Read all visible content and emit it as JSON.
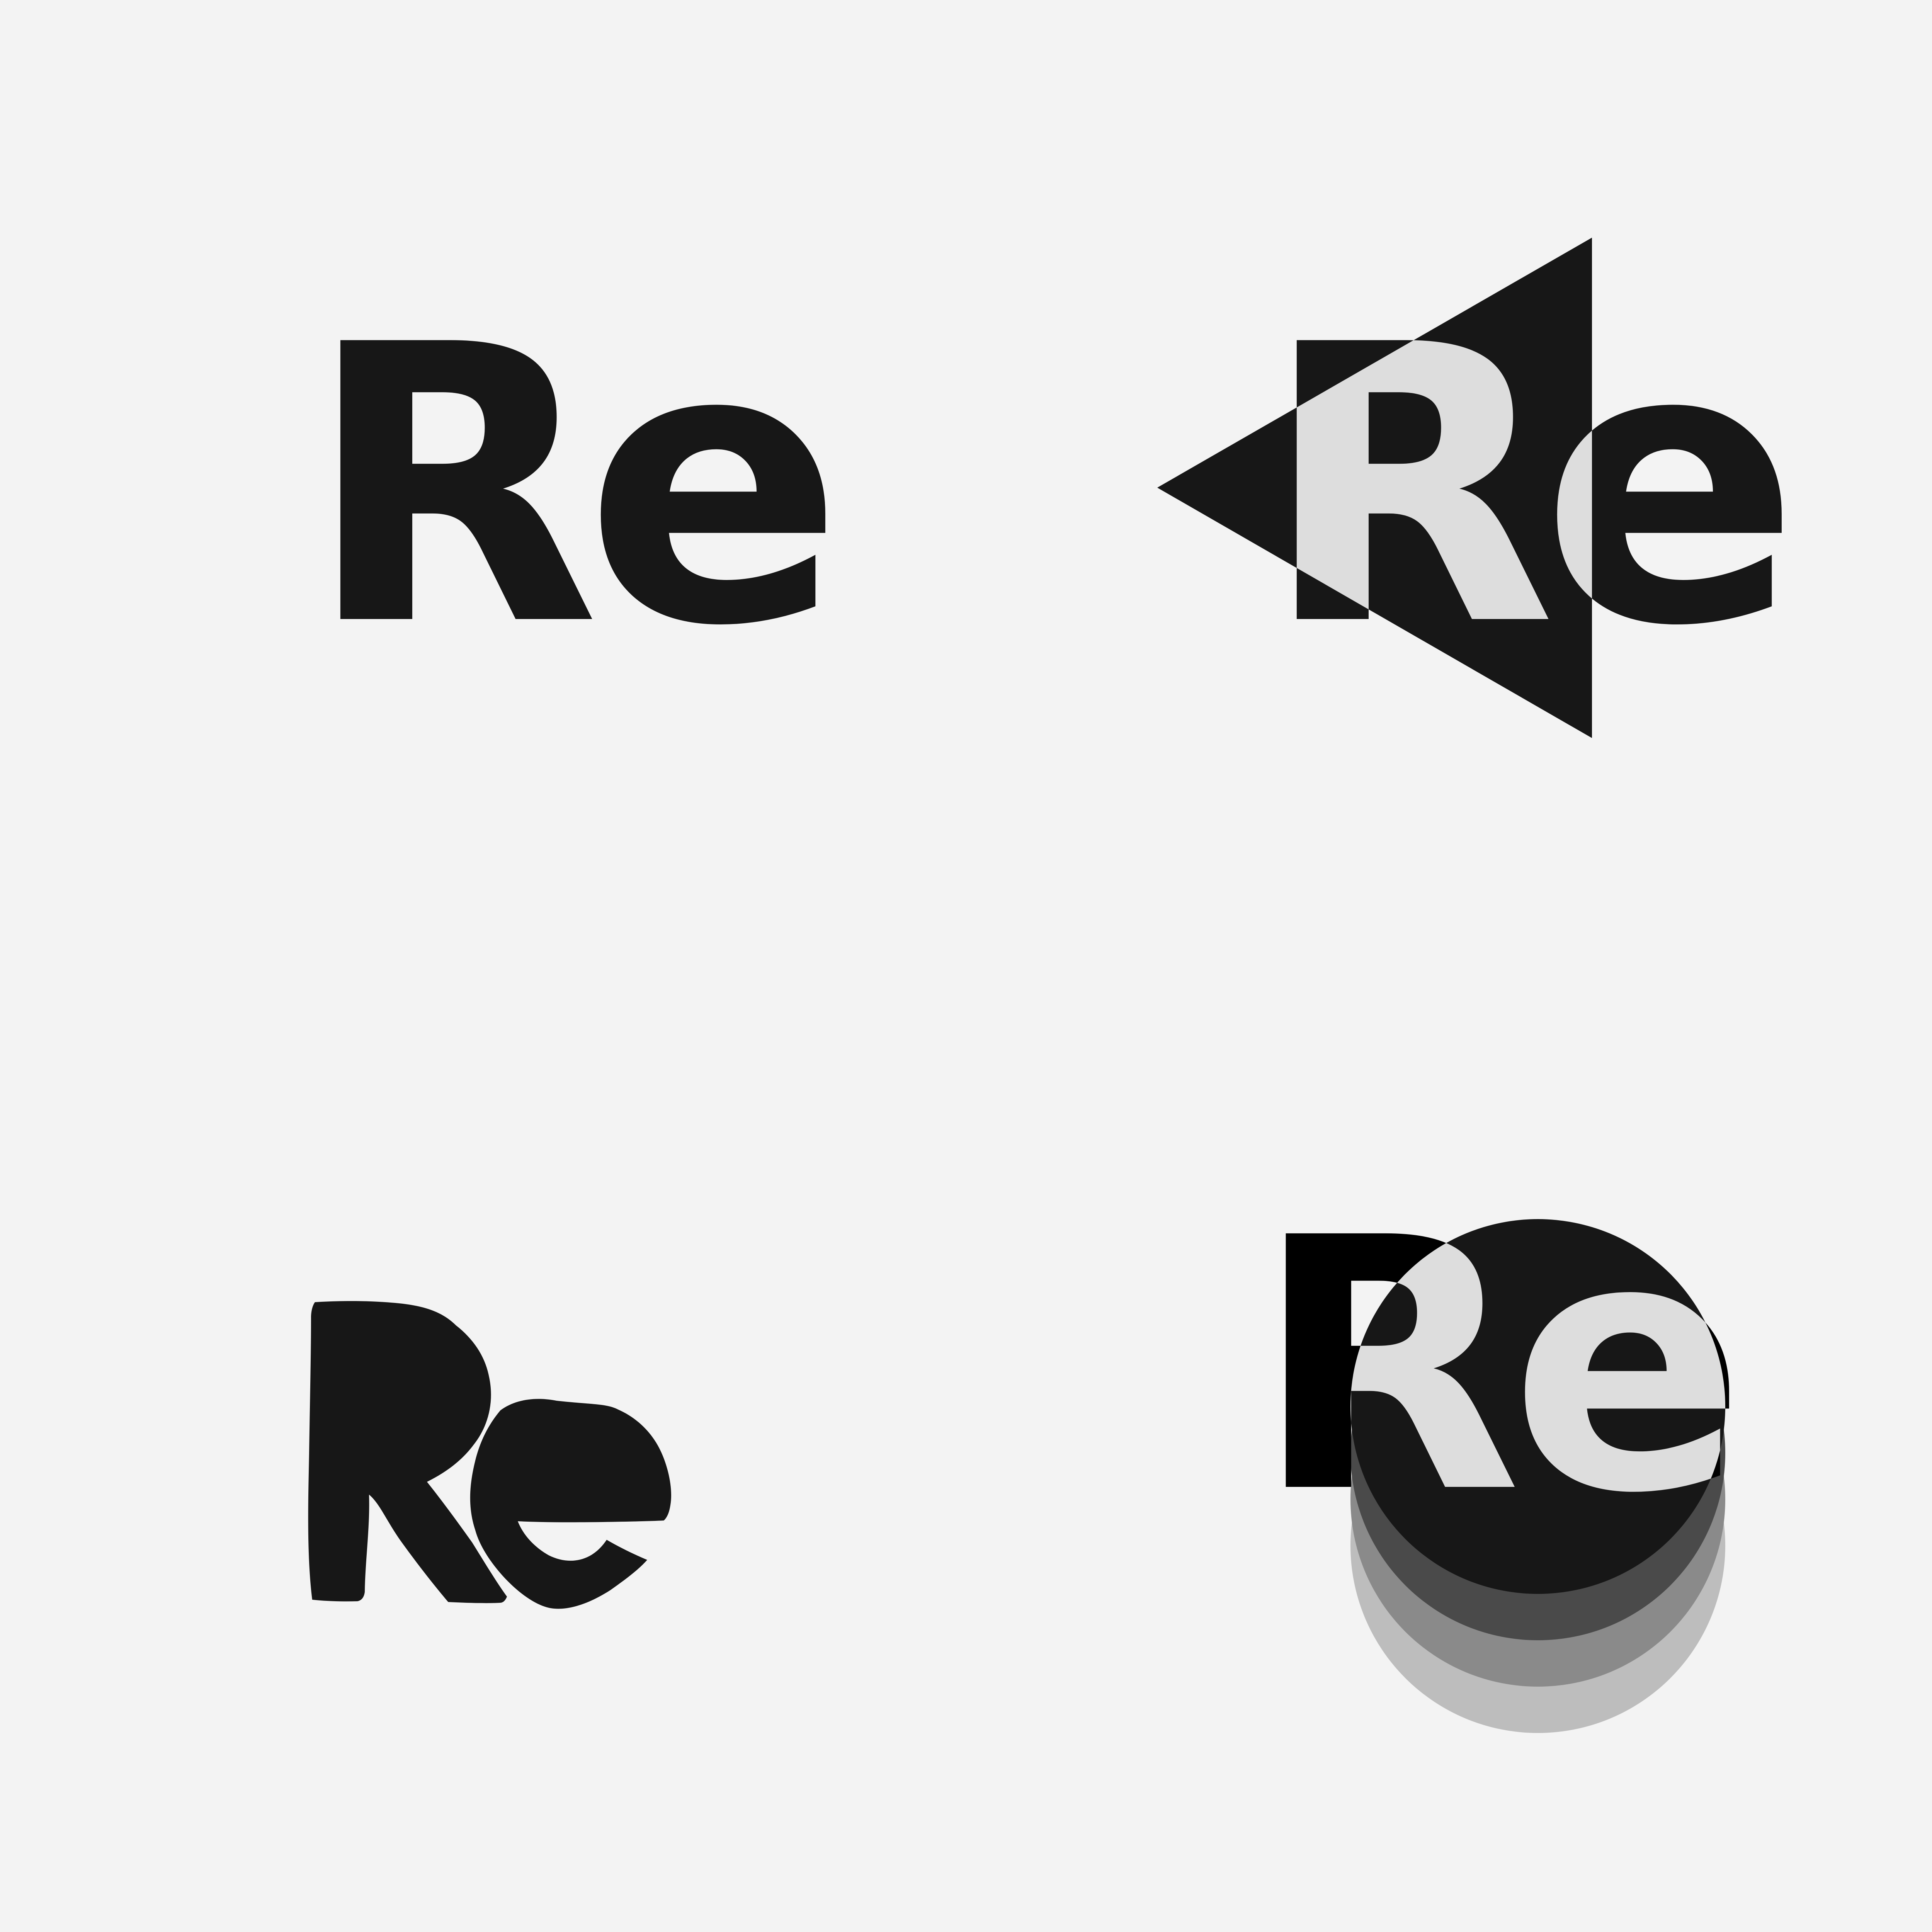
{
  "canvas": {
    "background": "#f3f3f3"
  },
  "variants": [
    {
      "id": "solid",
      "text": "Re",
      "style": "solid-wordmark",
      "colors": {
        "ink": "#171717"
      }
    },
    {
      "id": "triangle",
      "text": "Re",
      "style": "wordmark-with-triangle-inversion",
      "colors": {
        "ink": "#171717",
        "inverse": "#dddddd"
      }
    },
    {
      "id": "handdrawn",
      "text": "Re",
      "style": "hand-drawn-wordmark",
      "colors": {
        "ink": "#171717"
      }
    },
    {
      "id": "circles",
      "text": "Re",
      "style": "wordmark-over-stacked-circles",
      "colors": {
        "ink": "#000000",
        "inverse": "#dddddd",
        "circle_top": "#171717",
        "circle_layers": [
          "#4a4a4a",
          "#8a8a8a",
          "#bdbdbd"
        ]
      }
    }
  ]
}
